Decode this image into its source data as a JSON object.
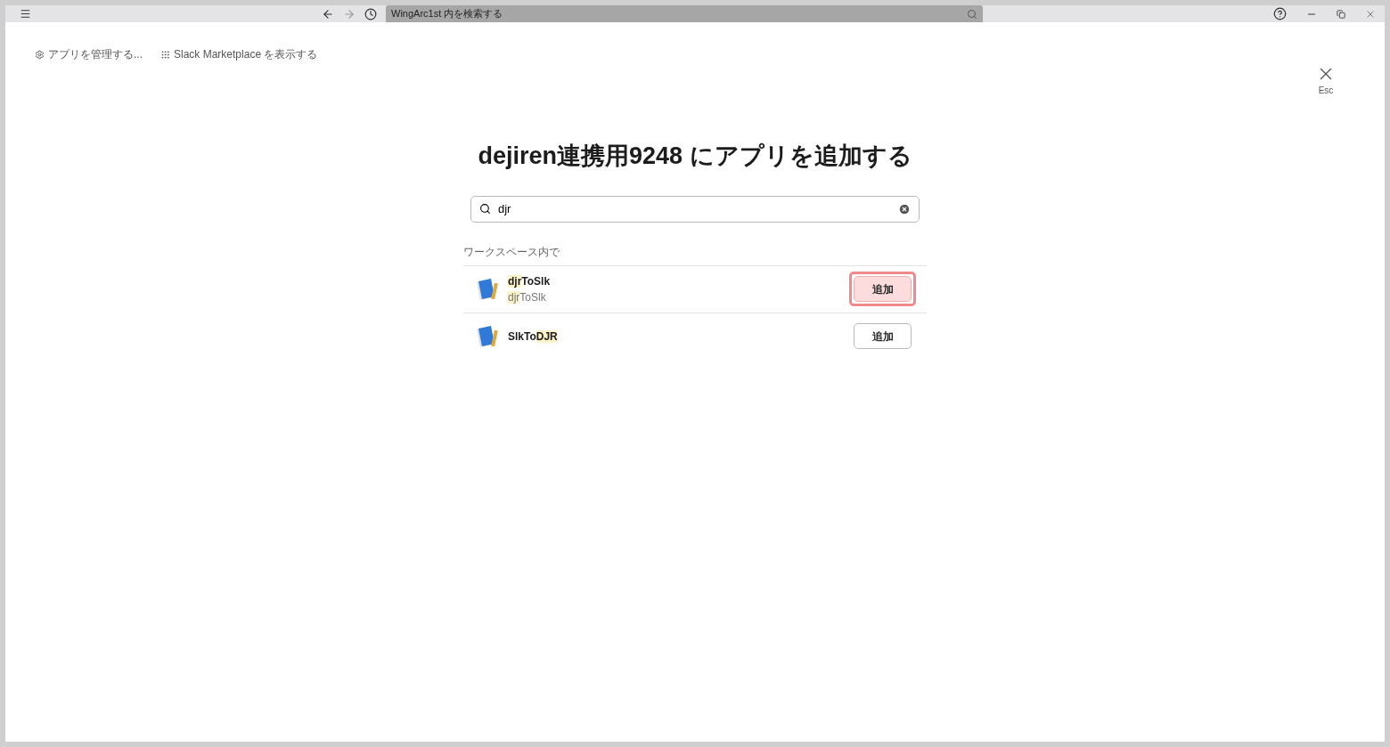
{
  "titlebar": {
    "search_placeholder": "WingArc1st 内を検索する"
  },
  "top_links": [
    {
      "kind": "gear",
      "label": "アプリを管理する..."
    },
    {
      "kind": "grid",
      "label": "Slack Marketplace を表示する"
    }
  ],
  "close": {
    "label": "Esc"
  },
  "heading": "dejiren連携用9248 にアプリを追加する",
  "search": {
    "value": "djr"
  },
  "section_label": "ワークスペース内で",
  "apps": [
    {
      "name": [
        {
          "text": "djr",
          "match": true
        },
        {
          "text": "ToSlk",
          "match": false
        }
      ],
      "subtitle": [
        {
          "text": "djr",
          "match": true
        },
        {
          "text": "ToSlk",
          "match": false
        }
      ],
      "button": "追加",
      "emphasized": true
    },
    {
      "name": [
        {
          "text": "SlkTo",
          "match": false
        },
        {
          "text": "DJR",
          "match": true
        }
      ],
      "button": "追加",
      "emphasized": false
    }
  ]
}
